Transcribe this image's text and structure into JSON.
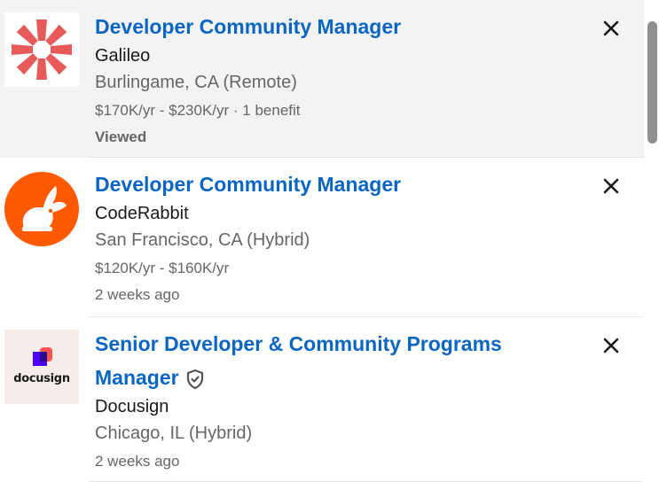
{
  "jobs": [
    {
      "title": "Developer Community Manager",
      "company": "Galileo",
      "location": "Burlingame, CA (Remote)",
      "salary": "$170K/yr - $230K/yr · 1 benefit",
      "status": "Viewed",
      "logo_icon": "galileo-starburst-logo",
      "verified": false
    },
    {
      "title": "Developer Community Manager",
      "company": "CodeRabbit",
      "location": "San Francisco, CA (Hybrid)",
      "salary": "$120K/yr - $160K/yr",
      "status": "2 weeks ago",
      "logo_icon": "coderabbit-rabbit-logo",
      "verified": false
    },
    {
      "title_line1": "Senior Developer & Community Programs",
      "title_line2": "Manager",
      "company": "Docusign",
      "location": "Chicago, IL (Hybrid)",
      "status": "2 weeks ago",
      "logo_icon": "docusign-logo",
      "logo_text": "docusign",
      "verified": true
    }
  ],
  "colors": {
    "title": "#0a66c2",
    "viewed_bg": "#f3f3f3",
    "galileo": "#e8595a",
    "coderabbit": "#ff5a00",
    "docusign_bg": "#f5ede9"
  }
}
